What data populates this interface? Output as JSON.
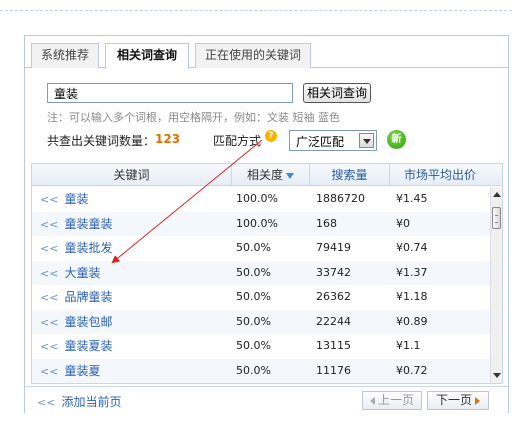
{
  "tabs": [
    {
      "label": "系统推荐"
    },
    {
      "label": "相关词查询"
    },
    {
      "label": "正在使用的关键词"
    }
  ],
  "search": {
    "value": "童装",
    "button_label": "相关词查询",
    "note": "注：可以输入多个词根，用空格隔开，例如：文装 短袖 蓝色"
  },
  "summary": {
    "count_label": "共查出关键词数量：",
    "count_value": "123",
    "match_label": "匹配方式",
    "match_value": "广泛匹配",
    "new_badge": "新"
  },
  "table": {
    "headers": [
      "关键词",
      "相关度",
      "搜索量",
      "市场平均出价"
    ],
    "rows": [
      {
        "keyword": "童装",
        "relevance": "100.0%",
        "searches": "1886720",
        "price": "¥1.45"
      },
      {
        "keyword": "童装童装",
        "relevance": "100.0%",
        "searches": "168",
        "price": "¥0"
      },
      {
        "keyword": "童装批发",
        "relevance": "50.0%",
        "searches": "79419",
        "price": "¥0.74"
      },
      {
        "keyword": "大童装",
        "relevance": "50.0%",
        "searches": "33742",
        "price": "¥1.37"
      },
      {
        "keyword": "品牌童装",
        "relevance": "50.0%",
        "searches": "26362",
        "price": "¥1.18"
      },
      {
        "keyword": "童装包邮",
        "relevance": "50.0%",
        "searches": "22244",
        "price": "¥0.89"
      },
      {
        "keyword": "童装夏装",
        "relevance": "50.0%",
        "searches": "13115",
        "price": "¥1.1"
      },
      {
        "keyword": "童装夏",
        "relevance": "50.0%",
        "searches": "11176",
        "price": "¥0.72"
      }
    ]
  },
  "footer": {
    "add_label": "添加当前页",
    "prev_label": "上一页",
    "next_label": "下一页"
  },
  "icons": {
    "row_prefix": "chevron-double-left-icon",
    "help": "help-icon",
    "sort": "sort-desc-icon"
  },
  "colors": {
    "link": "#2a62b4",
    "count": "#e07000",
    "annotation_arrow": "#e02020",
    "border": "#b7cbe2"
  }
}
